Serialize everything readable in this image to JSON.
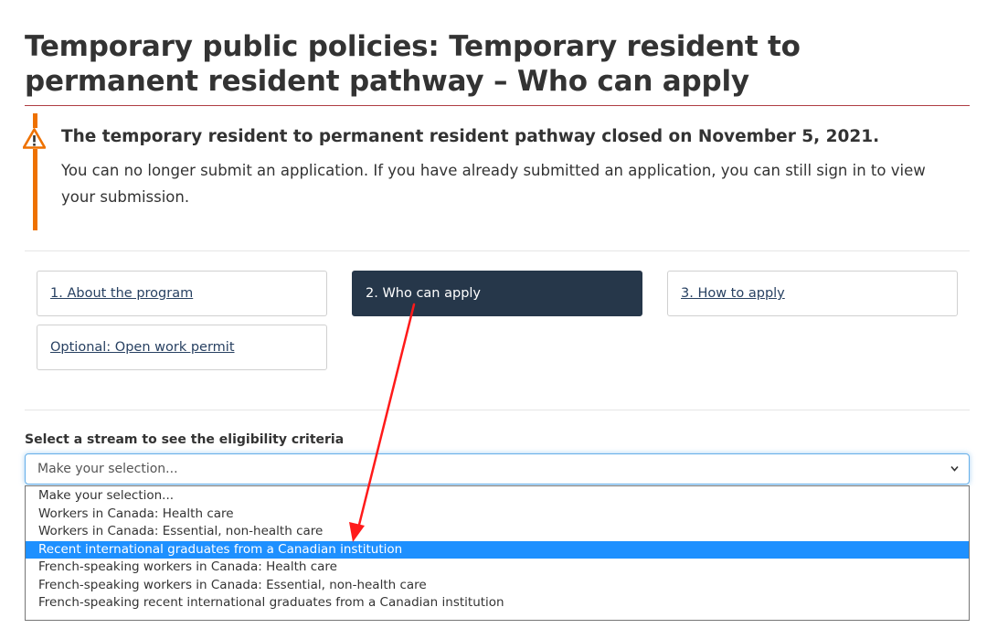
{
  "page_title": "Temporary public policies: Temporary resident to permanent resident pathway – Who can apply",
  "alert": {
    "icon": "warning-triangle-icon",
    "heading": "The temporary resident to permanent resident pathway closed on November 5, 2021.",
    "body": "You can no longer submit an application. If you have already submitted an application, you can still sign in to view your submission."
  },
  "steps": [
    {
      "label": "1. About the program",
      "active": false
    },
    {
      "label": "2. Who can apply",
      "active": true
    },
    {
      "label": "3. How to apply",
      "active": false
    },
    {
      "label": "Optional: Open work permit",
      "active": false
    }
  ],
  "stream_select": {
    "label": "Select a stream to see the eligibility criteria",
    "value": "Make your selection...",
    "chevron_icon": "chevron-down-icon",
    "options": [
      "Make your selection...",
      "Workers in Canada: Health care",
      "Workers in Canada: Essential, non-health care",
      "Recent international graduates from a Canadian institution",
      "French-speaking workers in Canada: Health care",
      "French-speaking workers in Canada: Essential, non-health care",
      "French-speaking recent international graduates from a Canadian institution"
    ],
    "highlighted_index": 3
  },
  "colors": {
    "title_rule": "#af3c43",
    "alert_bar": "#ee7100",
    "active_step": "#26374a",
    "link": "#284162",
    "option_highlight": "#1e90ff",
    "annotation_arrow": "#ff1a1a"
  }
}
